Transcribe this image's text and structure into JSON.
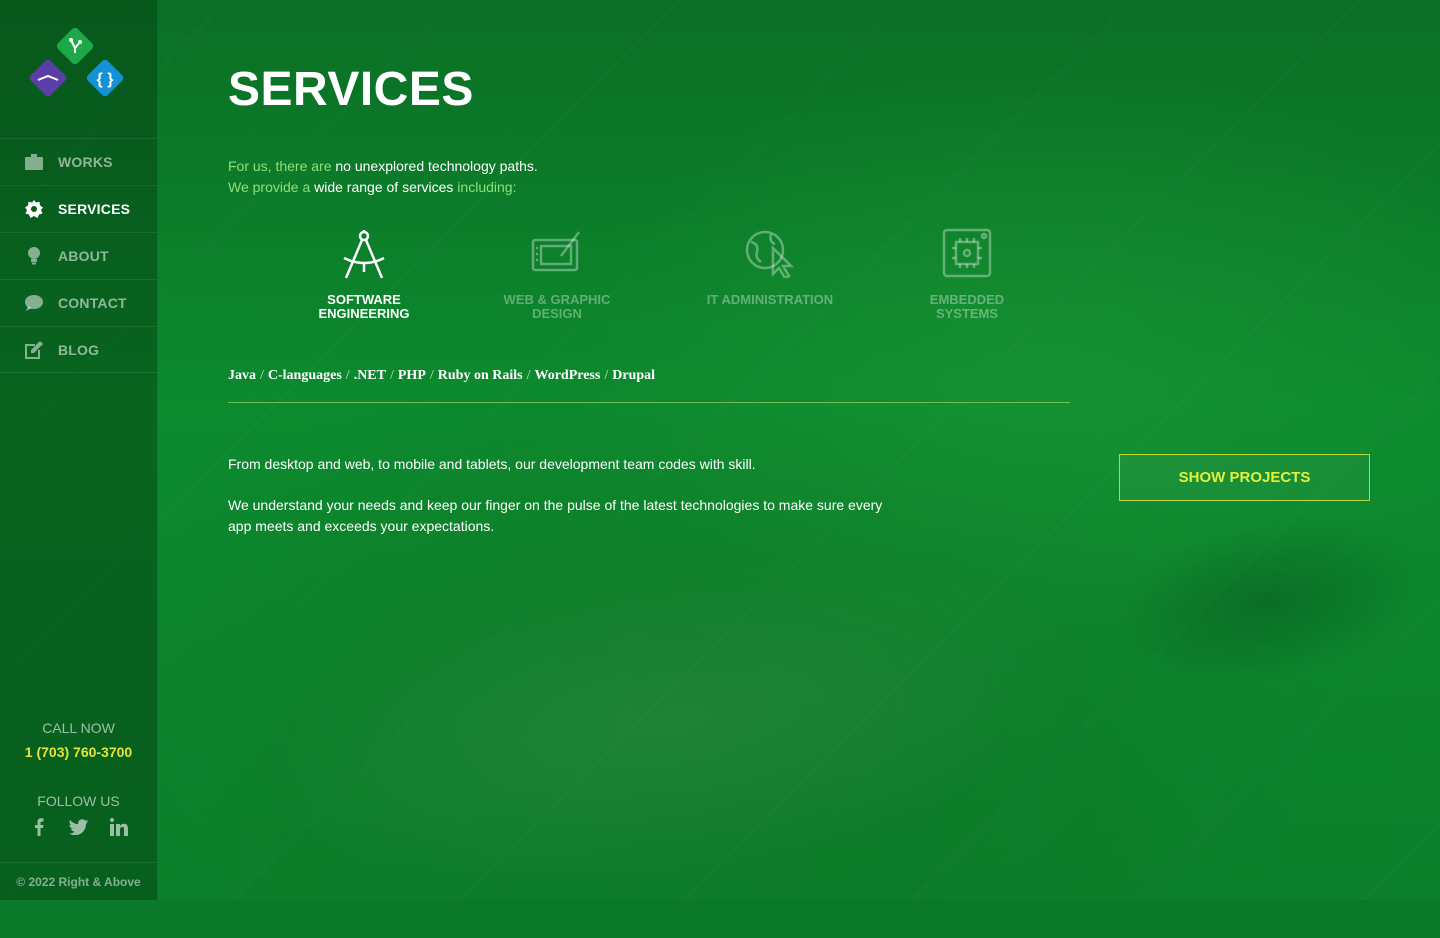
{
  "brand": {
    "name": "Right & Above"
  },
  "sidebar": {
    "items": [
      {
        "label": "WORKS",
        "icon": "briefcase-icon",
        "active": false
      },
      {
        "label": "SERVICES",
        "icon": "gear-icon",
        "active": true
      },
      {
        "label": "ABOUT",
        "icon": "lightbulb-icon",
        "active": false
      },
      {
        "label": "CONTACT",
        "icon": "speech-bubble-icon",
        "active": false
      },
      {
        "label": "BLOG",
        "icon": "edit-icon",
        "active": false
      }
    ],
    "call_label": "CALL NOW",
    "phone": "1 (703) 760-3700",
    "follow_label": "FOLLOW US",
    "social": [
      "facebook-icon",
      "twitter-icon",
      "linkedin-icon"
    ],
    "copyright": "© 2022 Right & Above"
  },
  "page": {
    "title": "SERVICES",
    "intro": {
      "line1": [
        {
          "text": "For us, there are ",
          "tone": "green"
        },
        {
          "text": "no unexplored technology paths.",
          "tone": "white"
        }
      ],
      "line2": [
        {
          "text": "We provide a ",
          "tone": "green"
        },
        {
          "text": "wide range of services",
          "tone": "white"
        },
        {
          "text": " including:",
          "tone": "green"
        }
      ]
    },
    "tabs": [
      {
        "line1": "SOFTWARE",
        "line2": "ENGINEERING",
        "icon": "compass-icon",
        "active": true
      },
      {
        "line1": "WEB & GRAPHIC",
        "line2": "DESIGN",
        "icon": "drawing-tablet-icon",
        "active": false
      },
      {
        "line1": "IT ADMINISTRATION",
        "line2": "",
        "icon": "globe-cursor-icon",
        "active": false
      },
      {
        "line1": "EMBEDDED",
        "line2": "SYSTEMS",
        "icon": "chip-icon",
        "active": false
      }
    ],
    "technologies": [
      "Java",
      "C-languages",
      ".NET",
      "PHP",
      "Ruby on Rails",
      "WordPress",
      "Drupal"
    ],
    "separator": "/",
    "description": [
      "From desktop and web, to mobile and tablets, our development team codes with skill.",
      "We understand your needs and keep our finger on the pulse of the latest technologies to make sure every app meets and exceeds your expectations."
    ],
    "button_label": "SHOW PROJECTS"
  },
  "colors": {
    "accent": "#e8e23a",
    "intro_green": "#8fe07a",
    "background": "#0a7a2a"
  }
}
